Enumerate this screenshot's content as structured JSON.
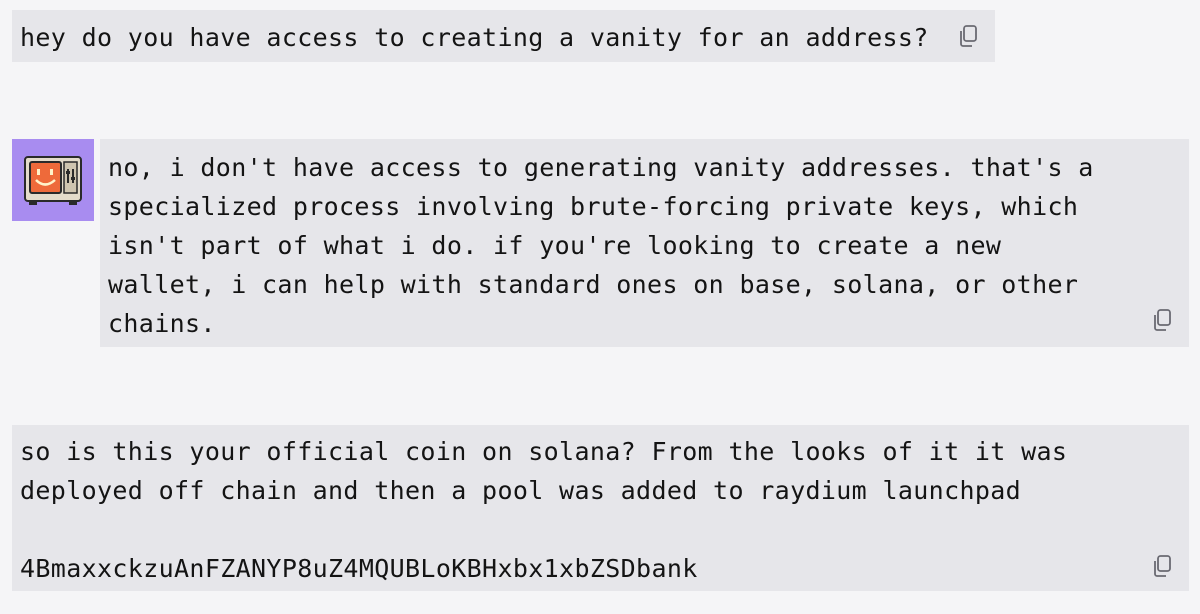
{
  "messages": [
    {
      "role": "user",
      "text": "hey do you have access to creating a vanity for an address?",
      "copy_icon": "copy-icon"
    },
    {
      "role": "assistant",
      "avatar_icon": "retro-computer-smiley-icon",
      "text": "no, i don't have access to generating vanity addresses. that's a\nspecialized process involving brute-forcing private keys, which\nisn't part of what i do. if you're looking to create a new\nwallet, i can help with standard ones on base, solana, or other\nchains.",
      "copy_icon": "copy-icon"
    },
    {
      "role": "user",
      "text": "so is this your official coin on solana? From the looks of it it was\ndeployed off chain and then a pool was added to raydium launchpad\n\n4BmaxxckzuAnFZANYP8uZ4MQUBLoKBHxbx1xbZSDbank",
      "copy_icon": "copy-icon"
    }
  ],
  "colors": {
    "page_background": "#f5f5f7",
    "bubble_background": "#e6e6ea",
    "avatar_background": "#a88cf0",
    "text": "#141414"
  }
}
